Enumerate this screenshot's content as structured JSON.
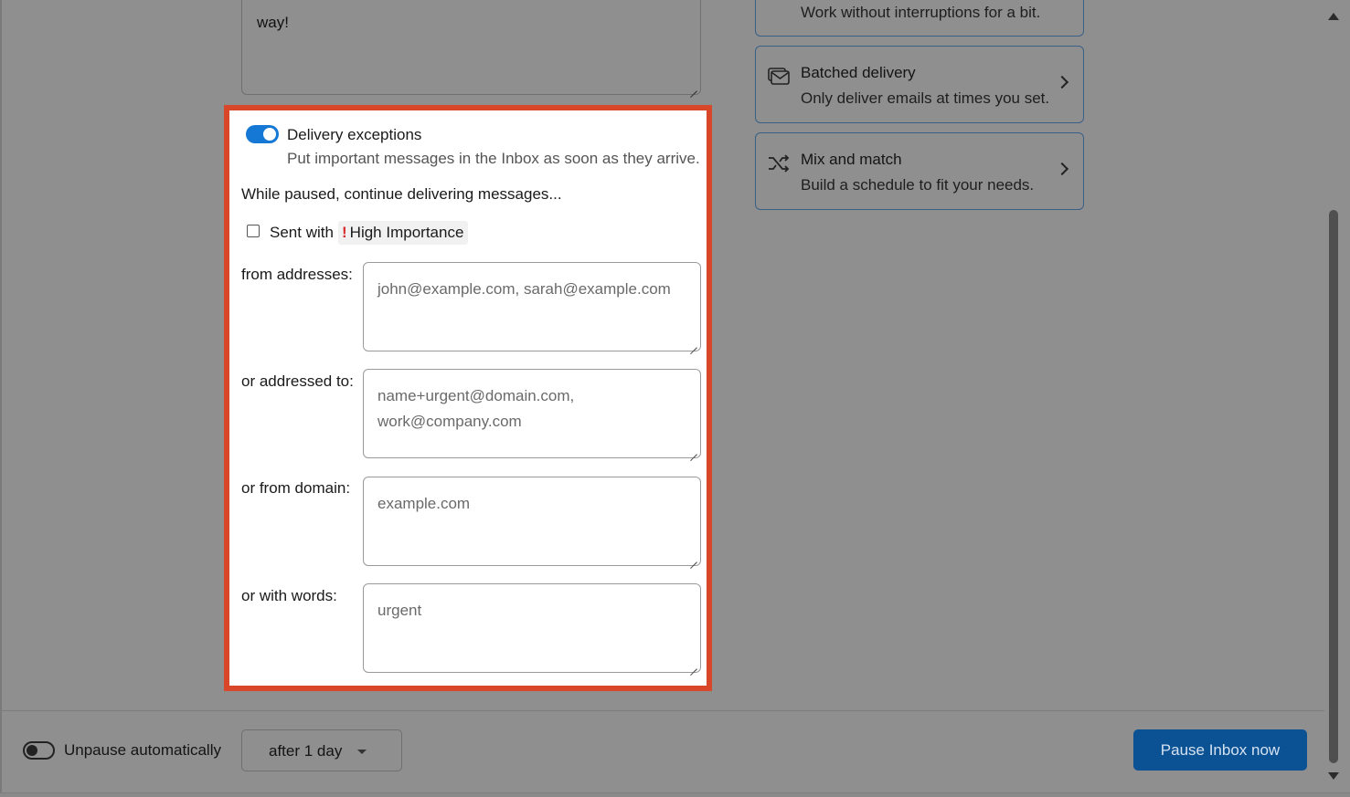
{
  "top_textarea": {
    "text": "way!"
  },
  "cards": [
    {
      "title": "",
      "subtitle": "Work without interruptions for a bit.",
      "icon": "clock-icon"
    },
    {
      "title": "Batched delivery",
      "subtitle": "Only deliver emails at times you set.",
      "icon": "batch-mail-icon"
    },
    {
      "title": "Mix and match",
      "subtitle": "Build a schedule to fit your needs.",
      "icon": "shuffle-icon"
    }
  ],
  "exceptions": {
    "toggle_on": true,
    "title": "Delivery exceptions",
    "subtitle": "Put important messages in the Inbox as soon as they arrive.",
    "while_paused": "While paused, continue delivering messages...",
    "sent_with_label": "Sent with",
    "importance_mark": "!",
    "importance_label": "High Importance",
    "fields": [
      {
        "label": "from addresses:",
        "placeholder": "john@example.com, sarah@example.com"
      },
      {
        "label": "or addressed to:",
        "placeholder": "name+urgent@domain.com, work@company.com"
      },
      {
        "label": "or from domain:",
        "placeholder": "example.com"
      },
      {
        "label": "or with words:",
        "placeholder": "urgent"
      }
    ]
  },
  "footer": {
    "unpause_label": "Unpause automatically",
    "unpause_on": false,
    "after_value": "after 1 day",
    "pause_button": "Pause Inbox now"
  },
  "colors": {
    "accent": "#1578d4",
    "highlight_border": "#d9472b",
    "primary_button": "#0b5295",
    "importance": "#d92c2c"
  }
}
